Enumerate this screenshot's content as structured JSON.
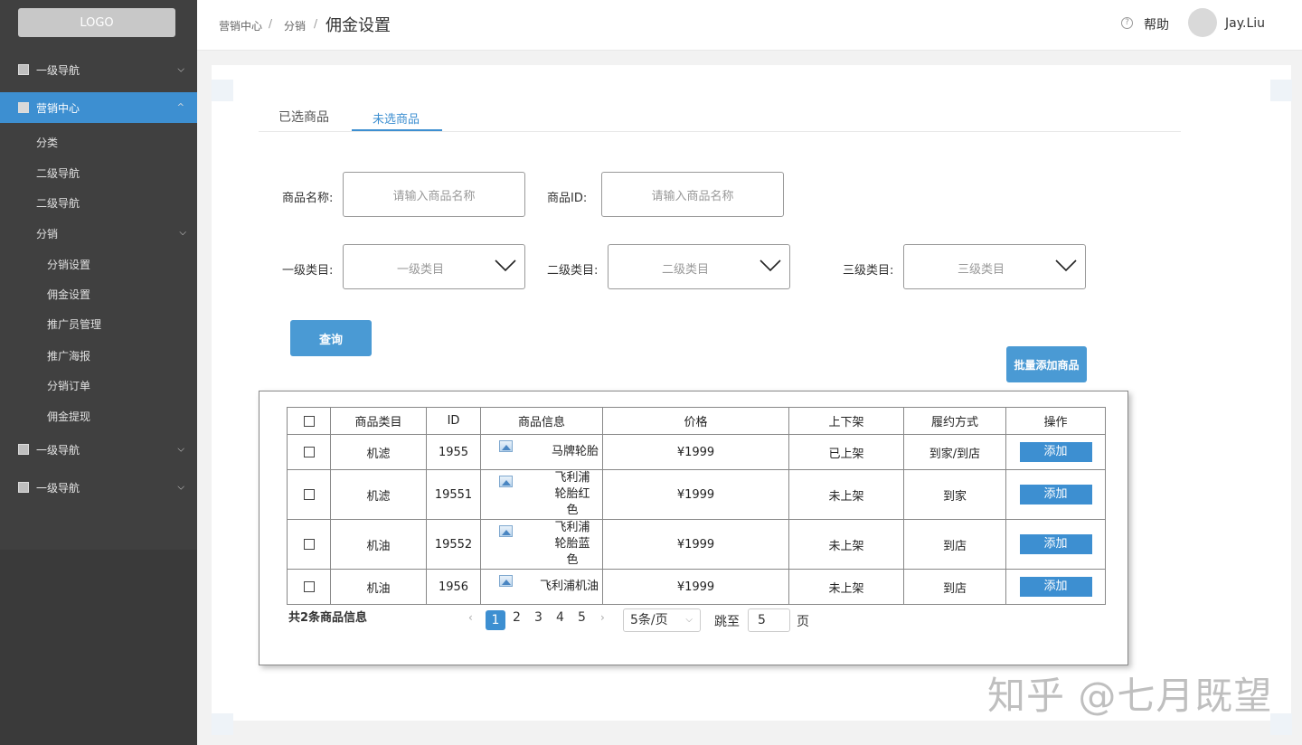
{
  "sidebar": {
    "logo": "LOGO",
    "items": [
      {
        "label": "一级导航"
      },
      {
        "label": "营销中心"
      },
      {
        "label": "分类"
      },
      {
        "label": "二级导航"
      },
      {
        "label": "二级导航"
      },
      {
        "label": "分销"
      },
      {
        "label": "分销设置"
      },
      {
        "label": "佣金设置"
      },
      {
        "label": "推广员管理"
      },
      {
        "label": "推广海报"
      },
      {
        "label": "分销订单"
      },
      {
        "label": "佣金提现"
      },
      {
        "label": "一级导航"
      },
      {
        "label": "一级导航"
      }
    ]
  },
  "header": {
    "breadcrumb": [
      "营销中心",
      "分销"
    ],
    "separator": "/",
    "current": "佣金设置",
    "help": "帮助",
    "help_icon": "?",
    "username": "Jay.Liu"
  },
  "tabs": {
    "selected": "已选商品",
    "unselected": "未选商品"
  },
  "form": {
    "name_label": "商品名称:",
    "name_placeholder": "请输入商品名称",
    "id_label": "商品ID:",
    "id_placeholder": "请输入商品名称",
    "cat1_label": "一级类目:",
    "cat1_placeholder": "一级类目",
    "cat2_label": "二级类目:",
    "cat2_placeholder": "二级类目",
    "cat3_label": "三级类目:",
    "cat3_placeholder": "三级类目",
    "query_button": "查询",
    "batch_add_button": "批量添加商品"
  },
  "table": {
    "headers": [
      "商品类目",
      "ID",
      "商品信息",
      "价格",
      "上下架",
      "履约方式",
      "操作"
    ],
    "rows": [
      {
        "category": "机滤",
        "id": "1955",
        "name": "马牌轮胎",
        "price": "¥1999",
        "status": "已上架",
        "fulfill": "到家/到店",
        "action": "添加"
      },
      {
        "category": "机滤",
        "id": "19551",
        "name": "飞利浦轮胎红色",
        "price": "¥1999",
        "status": "未上架",
        "fulfill": "到家",
        "action": "添加"
      },
      {
        "category": "机油",
        "id": "19552",
        "name": "飞利浦轮胎蓝色",
        "price": "¥1999",
        "status": "未上架",
        "fulfill": "到店",
        "action": "添加"
      },
      {
        "category": "机油",
        "id": "1956",
        "name": "飞利浦机油",
        "price": "¥1999",
        "status": "未上架",
        "fulfill": "到店",
        "action": "添加"
      }
    ]
  },
  "pagination": {
    "total": "共2条商品信息",
    "pages": [
      "1",
      "2",
      "3",
      "4",
      "5"
    ],
    "prev": "‹",
    "next": "›",
    "page_size": "5条/页",
    "jump_label": "跳至",
    "jump_value": "5",
    "page_unit": "页"
  },
  "watermark": "知乎 @七月既望",
  "colors": {
    "accent": "#3d8fd1",
    "sidebar": "#404040"
  }
}
